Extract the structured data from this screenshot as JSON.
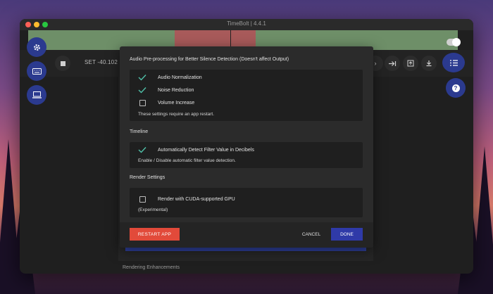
{
  "window": {
    "title": "TimeBolt | 4.4.1"
  },
  "toolbar": {
    "set_text": "SET -40.102 D"
  },
  "dialog": {
    "sections": [
      {
        "title": "Audio Pre-processing for Better Silence Detection (Doesn't affect Output)",
        "items": [
          {
            "label": "Audio Normalization",
            "checked": true
          },
          {
            "label": "Noise Reduction",
            "checked": true
          },
          {
            "label": "Volume Increase",
            "checked": false
          }
        ],
        "note": "These settings require an app restart."
      },
      {
        "title": "Timeline",
        "items": [
          {
            "label": "Automatically Detect Filter Value in Decibels",
            "checked": true
          }
        ],
        "note": "Enable / Disable automatic filter value detection."
      },
      {
        "title": "Render Settings",
        "items": [
          {
            "label": "Render with CUDA-supported GPU",
            "checked": false
          }
        ],
        "note": "(Experimental)"
      }
    ],
    "footer": {
      "restart_label": "RESTART APP",
      "cancel_label": "CANCEL",
      "done_label": "DONE"
    }
  },
  "background": {
    "rendering_label": "Rendering Enhancements"
  },
  "icons": {
    "settings": "gear-icon",
    "keyboard": "keyboard-icon",
    "screen": "monitor-icon",
    "stop": "stop-icon",
    "help": "question-icon",
    "list": "list-icon"
  },
  "colors": {
    "accent": "#2f3aa8",
    "restart": "#e24a3a",
    "check": "#4fc0a8"
  }
}
